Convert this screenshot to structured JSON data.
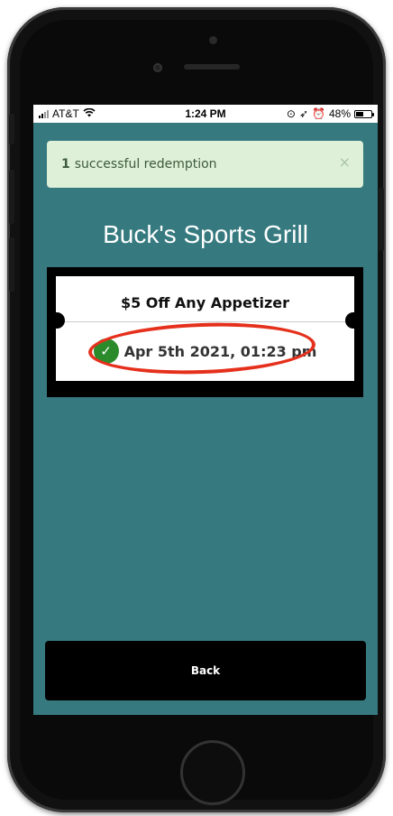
{
  "status_bar": {
    "carrier": "AT&T",
    "time": "1:24 PM",
    "battery": "48%",
    "battery_level": 0.48
  },
  "alert": {
    "count": "1",
    "message": "successful redemption",
    "close_glyph": "×"
  },
  "business": {
    "name": "Buck's Sports Grill"
  },
  "coupon": {
    "title": "$5 Off Any Appetizer",
    "redeemed_at": "Apr 5th 2021, 01:23 pm"
  },
  "actions": {
    "back_label": "Back"
  },
  "colors": {
    "screen_bg": "#367a80",
    "alert_bg": "#dff0d8",
    "success_green": "#2b8b2b",
    "highlight_red": "#e5301c"
  }
}
